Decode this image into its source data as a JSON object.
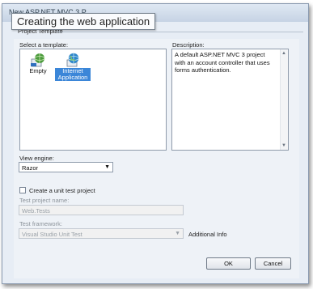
{
  "window": {
    "title": "New ASP.NET MVC 3 P",
    "tooltip": "Creating the web application"
  },
  "project_template": {
    "group_label": "Project Template",
    "select_label": "Select a template:",
    "templates": [
      {
        "label": "Empty",
        "icon": "web-empty-icon",
        "selected": false
      },
      {
        "label": "Internet Application",
        "icon": "web-globe-icon",
        "selected": true
      }
    ],
    "description_label": "Description:",
    "description_text": "A default ASP.NET MVC 3 project with an account controller that uses forms authentication."
  },
  "view_engine": {
    "label": "View engine:",
    "selected": "Razor"
  },
  "unit_test": {
    "checkbox_label": "Create a unit test project",
    "checked": false,
    "project_name_label": "Test project name:",
    "project_name_value": "Web.Tests",
    "framework_label": "Test framework:",
    "framework_value": "Visual Studio Unit Test",
    "additional_info": "Additional Info"
  },
  "buttons": {
    "ok": "OK",
    "cancel": "Cancel"
  },
  "colors": {
    "selection": "#3b86d8",
    "window_bg": "#e7edf5"
  }
}
